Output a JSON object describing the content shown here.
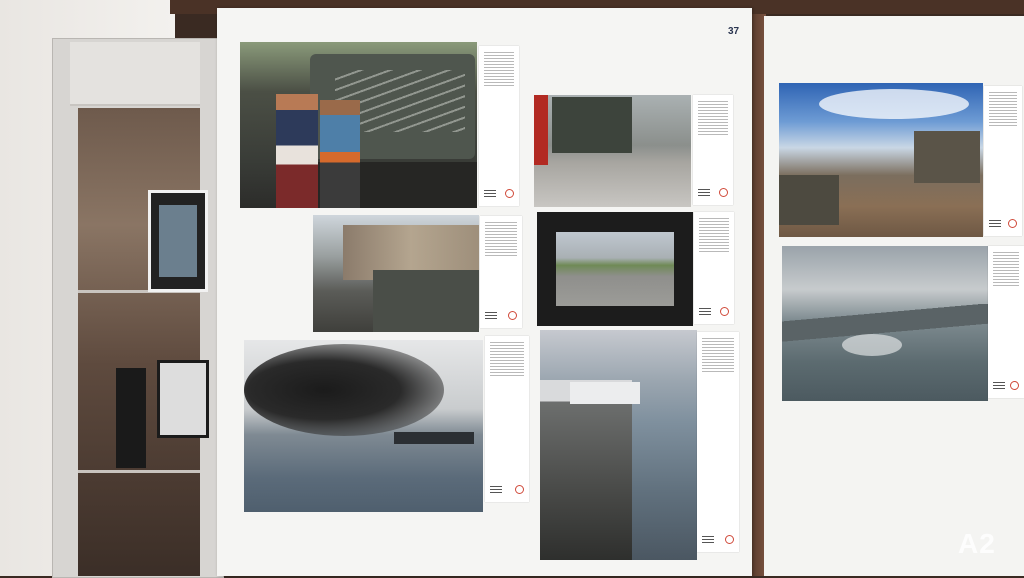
{
  "panel_number": "37",
  "watermark": "A2",
  "scene": {
    "photos": [
      {
        "id": "photo-girls-writing-on-tank"
      },
      {
        "id": "photo-tank-in-street"
      },
      {
        "id": "photo-tanks-in-town-square"
      },
      {
        "id": "photo-road-with-trees"
      },
      {
        "id": "photo-smoke-over-water"
      },
      {
        "id": "photo-landing-craft"
      },
      {
        "id": "photo-beach-vehicles"
      },
      {
        "id": "photo-soldiers-on-wreck"
      }
    ]
  }
}
